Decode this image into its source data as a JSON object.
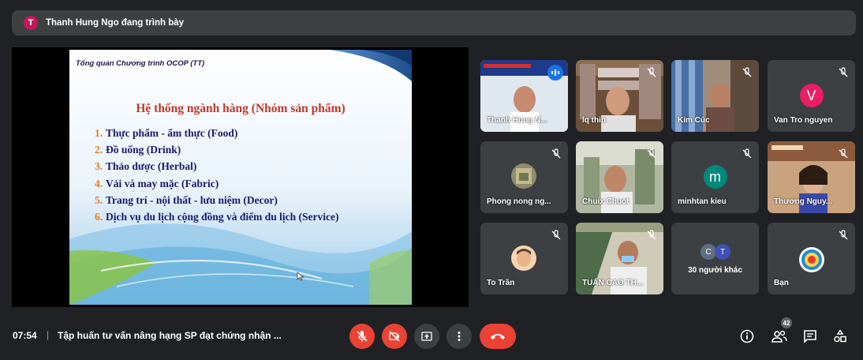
{
  "presenter": {
    "initial": "T",
    "text": "Thanh Hung Ngo đang trình bày"
  },
  "slide": {
    "header": "Tổng quan Chương trình OCOP (TT)",
    "title": "Hệ thống ngành hàng (Nhóm sản phẩm)",
    "items": [
      {
        "num": "1.",
        "text": "Thực phẩm - ẩm thực (Food)"
      },
      {
        "num": "2.",
        "text": "Đồ uống (Drink)"
      },
      {
        "num": "3.",
        "text": "Thảo dược (Herbal)"
      },
      {
        "num": "4.",
        "text": "Vải và may mặc (Fabric)"
      },
      {
        "num": "5.",
        "text": "Trang trí - nội thất - lưu niệm (Decor)"
      },
      {
        "num": "6.",
        "text": "Dịch vụ du lịch cộng đồng và điểm du lịch (Service)"
      }
    ]
  },
  "participants": {
    "p1": {
      "name": "Thanh Hung N..."
    },
    "p2": {
      "name": "lq thin"
    },
    "p3": {
      "name": "Kim Cúc"
    },
    "p4": {
      "name": "Van Tro nguyen",
      "initial": "V",
      "color": "#e91e63"
    },
    "p5": {
      "name": "Phong nong ng..."
    },
    "p6": {
      "name": "Chuix Chuot"
    },
    "p7": {
      "name": "minhtan kieu",
      "initial": "m",
      "color": "#00897b"
    },
    "p8": {
      "name": "Thương Nguy..."
    },
    "p9": {
      "name": "To Trần"
    },
    "p10": {
      "name": "TUẤN CAO TH..."
    },
    "p11": {
      "name": "30 người khác",
      "initial_a": "C",
      "initial_b": "T"
    },
    "p12": {
      "name": "Bạn"
    }
  },
  "bottom": {
    "time": "07:54",
    "separator": "|",
    "title": "Tập huấn tư vấn nâng hạng SP đạt chứng nhận ...",
    "people_count": "42"
  },
  "icons": {
    "mic_off": "mic-off-icon",
    "cam_off": "camera-off-icon",
    "present": "present-icon",
    "more": "more-vert-icon",
    "hangup": "call-end-icon",
    "info": "info-icon",
    "people": "people-icon",
    "chat": "chat-icon",
    "activities": "activities-icon"
  },
  "colors": {
    "danger": "#ea4335",
    "panel": "#3c4043",
    "background": "#202124",
    "accent": "#1a73e8"
  }
}
